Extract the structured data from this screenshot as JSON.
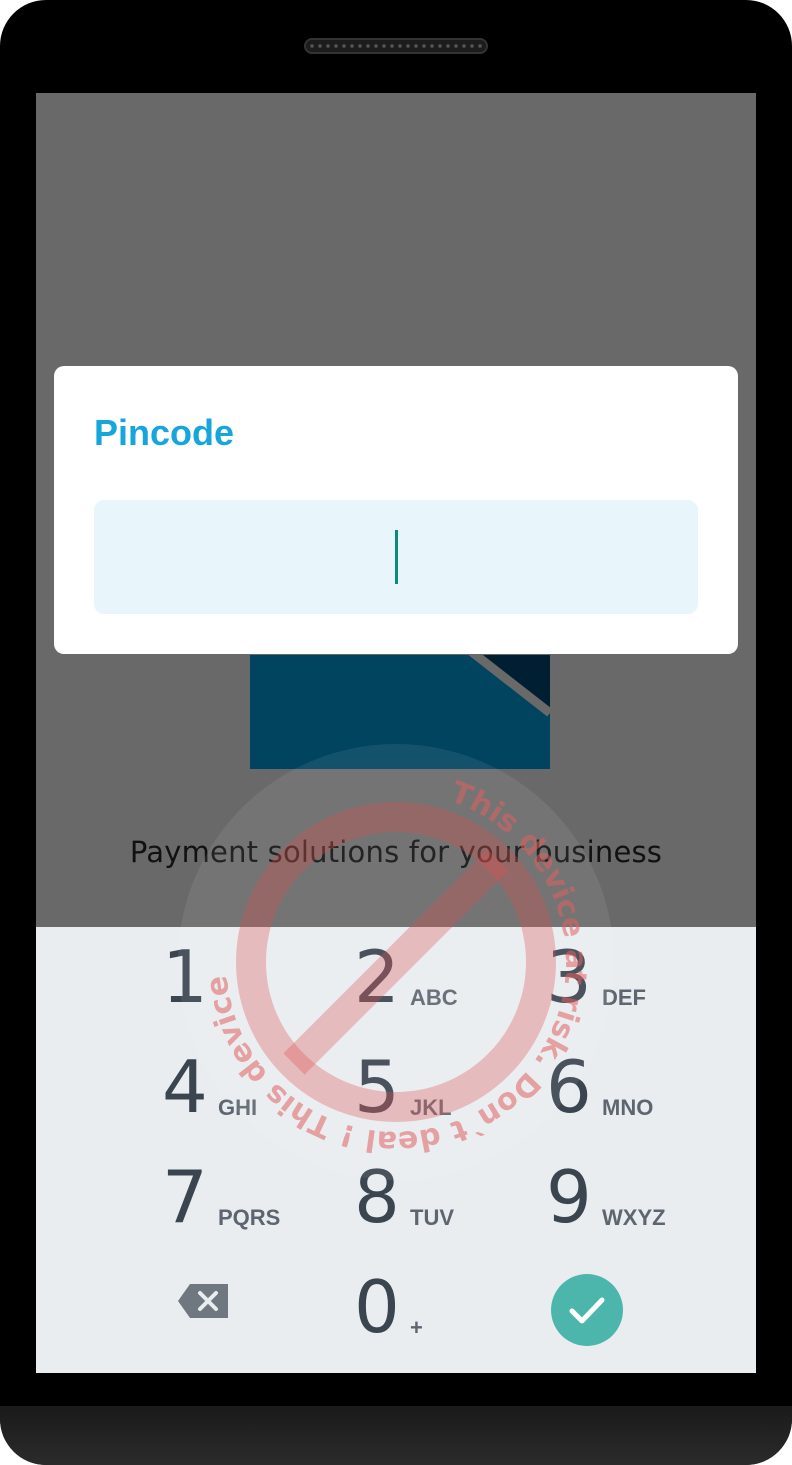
{
  "dialog": {
    "title": "Pincode",
    "pin_value": ""
  },
  "app": {
    "tagline": "Payment solutions for your business"
  },
  "keypad": {
    "keys": [
      {
        "digit": "1",
        "letters": ""
      },
      {
        "digit": "2",
        "letters": "ABC"
      },
      {
        "digit": "3",
        "letters": "DEF"
      },
      {
        "digit": "4",
        "letters": "GHI"
      },
      {
        "digit": "5",
        "letters": "JKL"
      },
      {
        "digit": "6",
        "letters": "MNO"
      },
      {
        "digit": "7",
        "letters": "PQRS"
      },
      {
        "digit": "8",
        "letters": "TUV"
      },
      {
        "digit": "9",
        "letters": "WXYZ"
      },
      {
        "digit": "0",
        "letters": "+"
      }
    ],
    "backspace_icon": "backspace-icon",
    "confirm_icon": "checkmark-icon"
  },
  "watermark": {
    "text": "This device at risk. Don`t deal ! This device at risk. Don`t deal !",
    "icon": "prohibited-icon"
  },
  "colors": {
    "accent": "#16a6dc",
    "cursor": "#0b8a80",
    "confirm": "#4db6ac",
    "field_bg": "#e8f6fb",
    "keypad_bg": "#eaedf0",
    "logo": "#004460",
    "watermark": "#e06060"
  }
}
